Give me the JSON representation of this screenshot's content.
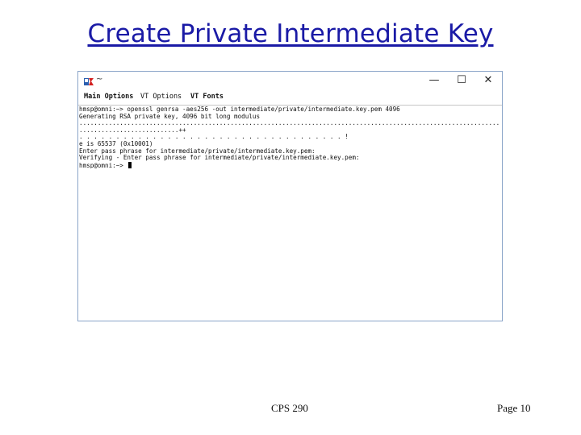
{
  "slide": {
    "title": "Create Private Intermediate Key",
    "footer_center": "CPS 290",
    "footer_right": "Page 10"
  },
  "window": {
    "icon": "putty-terminal-icon",
    "title_text": "~",
    "controls": {
      "minimize": "—",
      "maximize": "☐",
      "close": "✕"
    },
    "menu": [
      "Main Options",
      "VT Options",
      "VT Fonts"
    ]
  },
  "terminal": {
    "lines": [
      "hmsp@omni:~> openssl genrsa -aes256 -out intermediate/private/intermediate.key.pem 4096",
      "Generating RSA private key, 4096 bit long modulus",
      "...........................................................................................................................++",
      "...........................++",
      ". . . . . . . . . . . . . . . . . . . . . . . . . . . . . . . . . . . . !",
      "e is 65537 (0x10001)",
      "Enter pass phrase for intermediate/private/intermediate.key.pem:",
      "Verifying - Enter pass phrase for intermediate/private/intermediate.key.pem:",
      "hmsp@omni:~> "
    ]
  },
  "colors": {
    "title": "#1a1aa6",
    "window_border": "#8aa4c8",
    "icon_red": "#d22020",
    "icon_blue": "#2a5fb0"
  }
}
